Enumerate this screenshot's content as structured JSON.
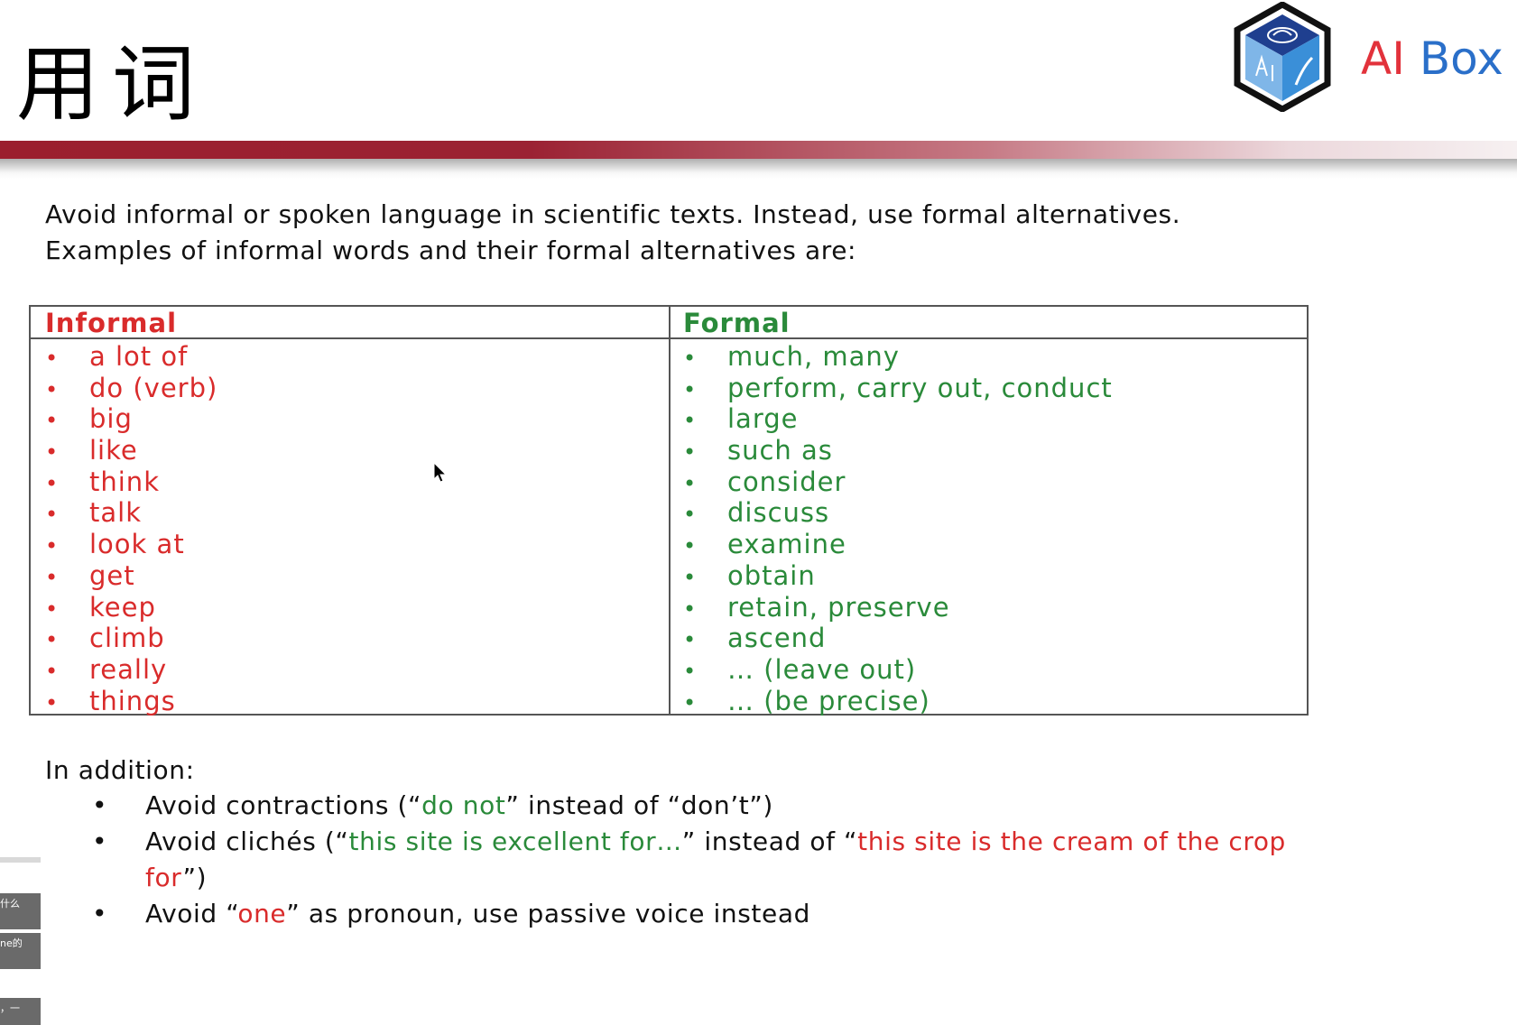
{
  "slide": {
    "title": "用词",
    "logo": {
      "ai": "AI",
      "box": "Box",
      "accent": "#e2323b",
      "brand": "#2a6fc9"
    },
    "intro": {
      "line1": "Avoid informal or spoken language in scientific texts. Instead, use formal alternatives.",
      "line2": "Examples of informal words and their formal alternatives are:"
    },
    "table": {
      "informal_header": "Informal",
      "formal_header": "Formal",
      "informal_color": "#d92b2b",
      "formal_color": "#2a8a3a",
      "informal_items": [
        "a lot of",
        "do (verb)",
        "big",
        "like",
        "think",
        "talk",
        "look at",
        "get",
        "keep",
        "climb",
        "really",
        "things"
      ],
      "formal_items": [
        "much, many",
        "perform, carry out, conduct",
        "large",
        "such as",
        "consider",
        "discuss",
        "examine",
        "obtain",
        "retain, preserve",
        "ascend",
        "… (leave out)",
        "… (be precise)"
      ]
    },
    "addition": {
      "heading": "In addition:",
      "bullets": [
        {
          "p1": "Avoid contractions (“",
          "good": "do not",
          "p2": "” instead of “don’t”)"
        },
        {
          "p1": "Avoid clichés (“",
          "good": "this site is excellent for…",
          "p2": "” instead of “",
          "bad": "this site is the cream of the crop for",
          "p3": "”)"
        },
        {
          "p1": "Avoid “",
          "bad": "one",
          "p2": "” as pronoun, use passive voice instead"
        }
      ]
    }
  },
  "overlay": {
    "tabs": [
      "什么",
      "ne的",
      "，一"
    ]
  }
}
